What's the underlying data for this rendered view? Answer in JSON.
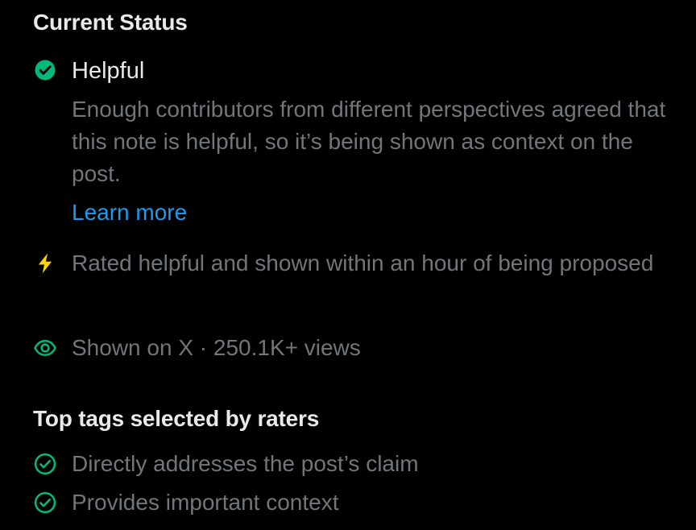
{
  "current_status": {
    "heading": "Current Status",
    "status_label": "Helpful",
    "status_icon": "check-circle-filled-icon",
    "description": "Enough contributors from different perspectives agreed that this note is helpful, so it’s being shown as context on the post.",
    "learn_more": "Learn more"
  },
  "highlights": {
    "rated_fast": "Rated helpful and shown within an hour of being proposed",
    "rated_fast_icon": "lightning-icon",
    "views": "Shown on X · 250.1K+ views",
    "views_icon": "eye-icon"
  },
  "top_tags": {
    "heading": "Top tags selected by raters",
    "tag_icon": "check-circle-outline-icon",
    "tags": [
      "Directly addresses the post’s claim",
      "Provides important context"
    ]
  },
  "colors": {
    "background": "#000000",
    "primary_text": "#e7e9ea",
    "secondary_text": "#71767b",
    "link": "#1d9bf0",
    "success": "#00ba7c",
    "lightning": "#ffd400"
  }
}
